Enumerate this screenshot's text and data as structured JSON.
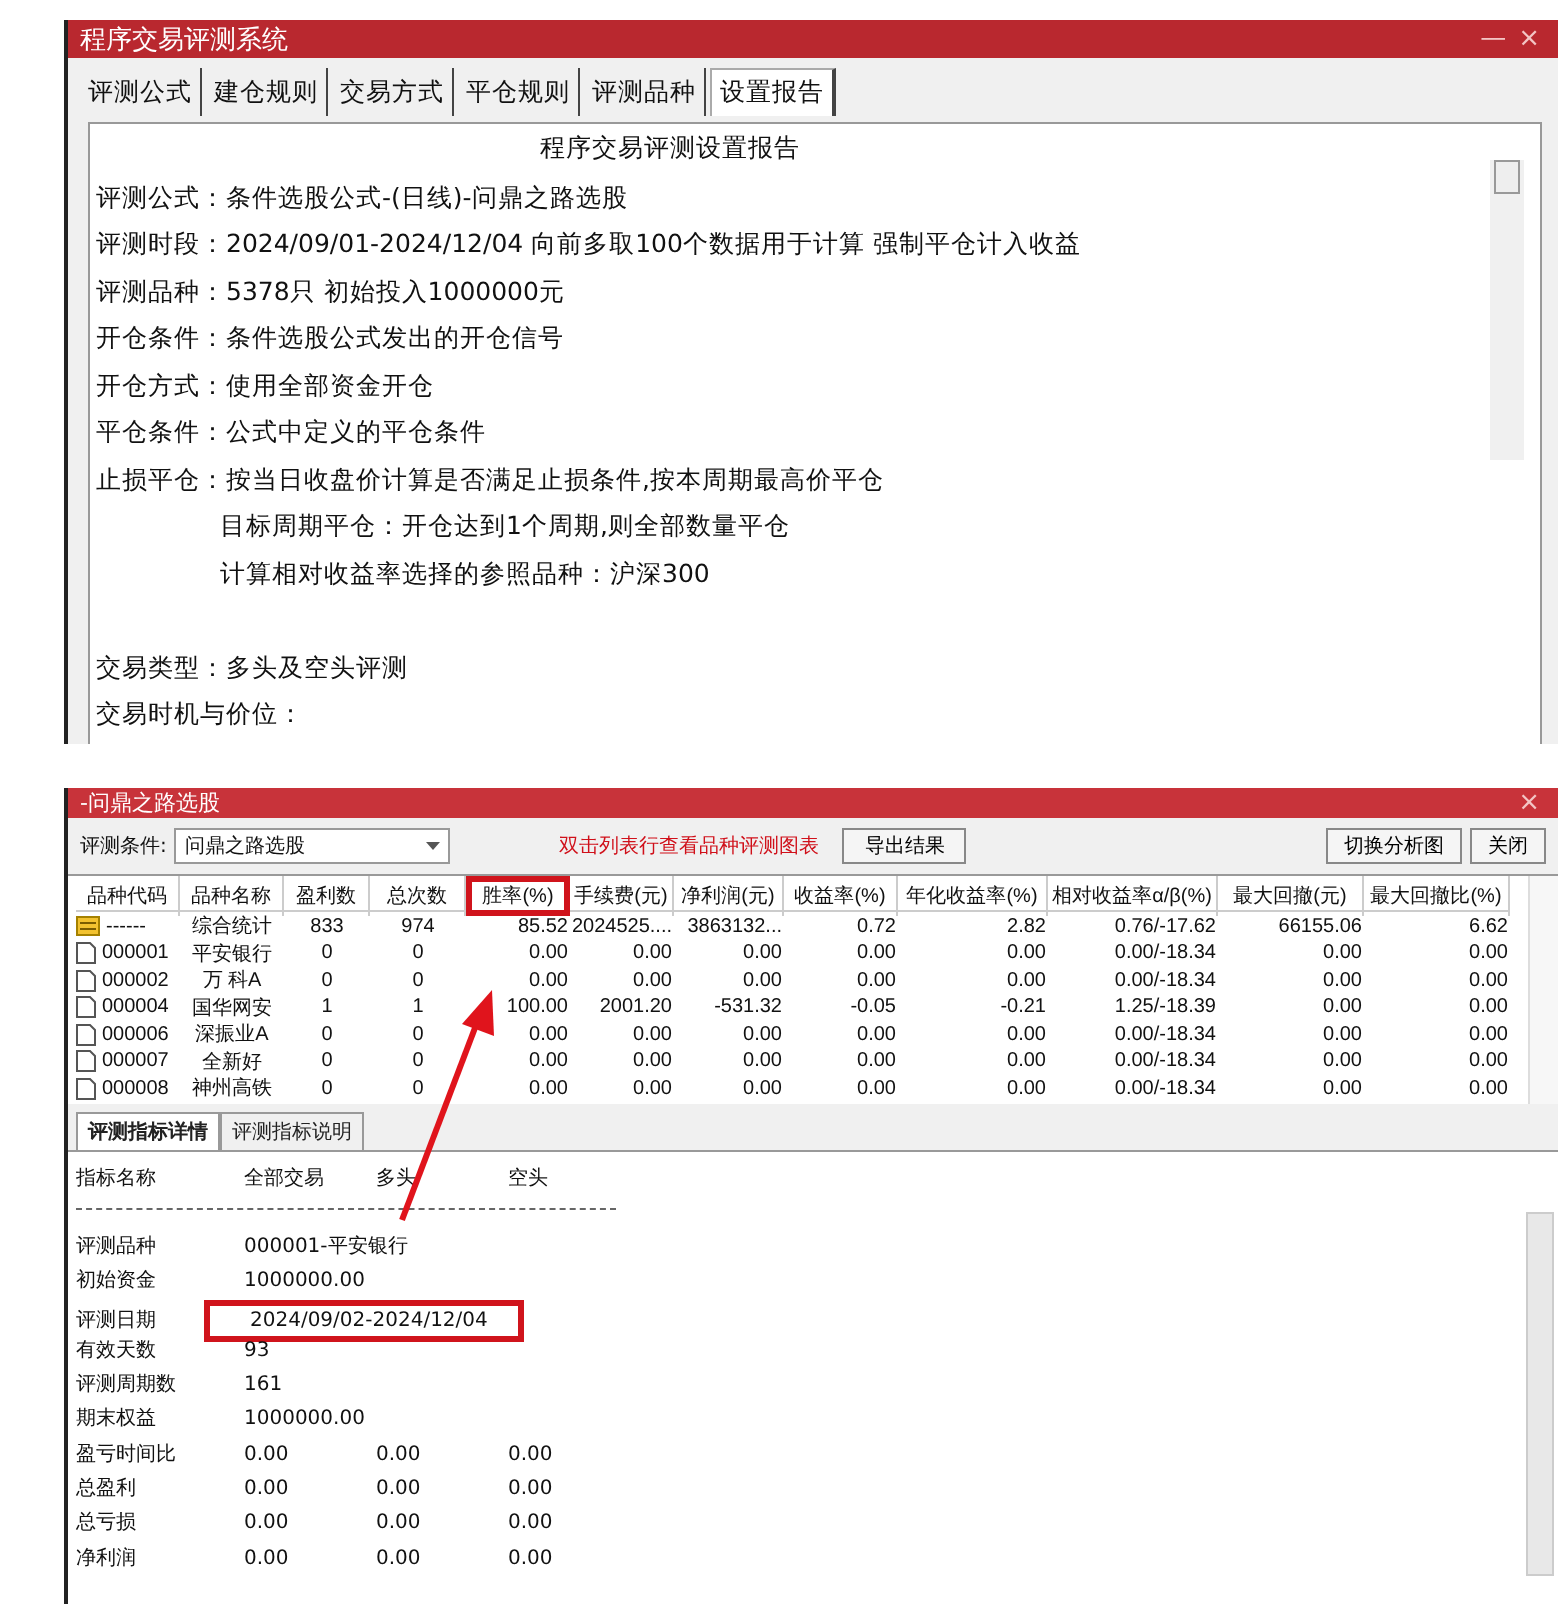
{
  "top_window": {
    "title": "程序交易评测系统",
    "controls": [
      "—",
      "×"
    ],
    "tabs": [
      {
        "label": "评测公式",
        "selected": false
      },
      {
        "label": "建仓规则",
        "selected": false
      },
      {
        "label": "交易方式",
        "selected": false
      },
      {
        "label": "平仓规则",
        "selected": false
      },
      {
        "label": "评测品种",
        "selected": false
      },
      {
        "label": "设置报告",
        "selected": true
      }
    ],
    "report": {
      "heading": "程序交易评测设置报告",
      "lines": [
        {
          "label": "评测公式：",
          "value": "条件选股公式-(日线)-问鼎之路选股"
        },
        {
          "label": "评测时段：",
          "value": "2024/09/01-2024/12/04 向前多取100个数据用于计算 强制平仓计入收益"
        },
        {
          "label": "评测品种：",
          "value": "5378只 初始投入1000000元"
        },
        {
          "label": "开仓条件：",
          "value": "条件选股公式发出的开仓信号"
        },
        {
          "label": "开仓方式：",
          "value": "使用全部资金开仓"
        },
        {
          "label": "平仓条件：",
          "value": "公式中定义的平仓条件"
        },
        {
          "label": "止损平仓：",
          "value": "按当日收盘价计算是否满足止损条件,按本周期最高价平仓"
        },
        {
          "kind": "sub",
          "value": "目标周期平仓：开仓达到1个周期,则全部数量平仓"
        },
        {
          "kind": "sub",
          "value": "计算相对收益率选择的参照品种：沪深300"
        },
        {
          "kind": "blank"
        },
        {
          "label": "交易类型：",
          "value": "多头及空头评测"
        },
        {
          "label": "交易时机与价位："
        }
      ]
    }
  },
  "bottom_window": {
    "title": "-问鼎之路选股",
    "close": "×",
    "condition_label": "评测条件:",
    "condition_value": "问鼎之路选股",
    "hint": "双击列表行查看品种评测图表",
    "buttons": [
      "导出结果",
      "切换分析图",
      "关闭"
    ],
    "table": {
      "columns": [
        {
          "label": "品种代码",
          "highlighted": false
        },
        {
          "label": "品种名称",
          "highlighted": false
        },
        {
          "label": "盈利数",
          "highlighted": false
        },
        {
          "label": "总次数",
          "highlighted": false
        },
        {
          "label": "胜率(%)",
          "highlighted": true
        },
        {
          "label": "手续费(元)",
          "highlighted": false
        },
        {
          "label": "净利润(元)",
          "highlighted": false
        },
        {
          "label": "收益率(%)",
          "highlighted": false
        },
        {
          "label": "年化收益率(%)",
          "highlighted": false
        },
        {
          "label": "相对收益率α/β(%)",
          "highlighted": false
        },
        {
          "label": "最大回撤(元)",
          "highlighted": false
        },
        {
          "label": "最大回撤比(%)",
          "highlighted": false
        }
      ],
      "rows": [
        {
          "kind": "summary",
          "cells": [
            "------",
            "综合统计",
            "833",
            "974",
            "85.52",
            "2024525....",
            "3863132...",
            "0.72",
            "2.82",
            "0.76/-17.62",
            "66155.06",
            "6.62"
          ]
        },
        {
          "kind": "stock",
          "cells": [
            "000001",
            "平安银行",
            "0",
            "0",
            "0.00",
            "0.00",
            "0.00",
            "0.00",
            "0.00",
            "0.00/-18.34",
            "0.00",
            "0.00"
          ]
        },
        {
          "kind": "stock",
          "cells": [
            "000002",
            "万 科A",
            "0",
            "0",
            "0.00",
            "0.00",
            "0.00",
            "0.00",
            "0.00",
            "0.00/-18.34",
            "0.00",
            "0.00"
          ]
        },
        {
          "kind": "stock",
          "cells": [
            "000004",
            "国华网安",
            "1",
            "1",
            "100.00",
            "2001.20",
            "-531.32",
            "-0.05",
            "-0.21",
            "1.25/-18.39",
            "0.00",
            "0.00"
          ]
        },
        {
          "kind": "stock",
          "cells": [
            "000006",
            "深振业A",
            "0",
            "0",
            "0.00",
            "0.00",
            "0.00",
            "0.00",
            "0.00",
            "0.00/-18.34",
            "0.00",
            "0.00"
          ]
        },
        {
          "kind": "stock",
          "cells": [
            "000007",
            "全新好",
            "0",
            "0",
            "0.00",
            "0.00",
            "0.00",
            "0.00",
            "0.00",
            "0.00/-18.34",
            "0.00",
            "0.00"
          ]
        },
        {
          "kind": "stock",
          "cells": [
            "000008",
            "神州高铁",
            "0",
            "0",
            "0.00",
            "0.00",
            "0.00",
            "0.00",
            "0.00",
            "0.00/-18.34",
            "0.00",
            "0.00"
          ]
        }
      ]
    },
    "detail_tabs": [
      {
        "label": "评测指标详情",
        "selected": true
      },
      {
        "label": "评测指标说明",
        "selected": false
      }
    ],
    "detail": {
      "columns": [
        "指标名称",
        "全部交易",
        "多头",
        "空头"
      ],
      "rows": [
        {
          "label": "评测品种",
          "values": [
            "000001-平安银行"
          ],
          "highlighted": false
        },
        {
          "label": "初始资金",
          "values": [
            "1000000.00"
          ],
          "highlighted": false
        },
        {
          "label": "评测日期",
          "values": [
            "2024/09/02-2024/12/04"
          ],
          "highlighted": true
        },
        {
          "label": "有效天数",
          "values": [
            "93"
          ],
          "highlighted": false
        },
        {
          "label": "评测周期数",
          "values": [
            "161"
          ],
          "highlighted": false
        },
        {
          "label": "期末权益",
          "values": [
            "1000000.00"
          ],
          "highlighted": false
        },
        {
          "label": "盈亏时间比",
          "values": [
            "0.00",
            "0.00",
            "0.00"
          ],
          "highlighted": false
        },
        {
          "label": "总盈利",
          "values": [
            "0.00",
            "0.00",
            "0.00"
          ],
          "highlighted": false
        },
        {
          "label": "总亏损",
          "values": [
            "0.00",
            "0.00",
            "0.00"
          ],
          "highlighted": false
        },
        {
          "label": "净利润",
          "values": [
            "0.00",
            "0.00",
            "0.00"
          ],
          "highlighted": false
        }
      ]
    }
  }
}
